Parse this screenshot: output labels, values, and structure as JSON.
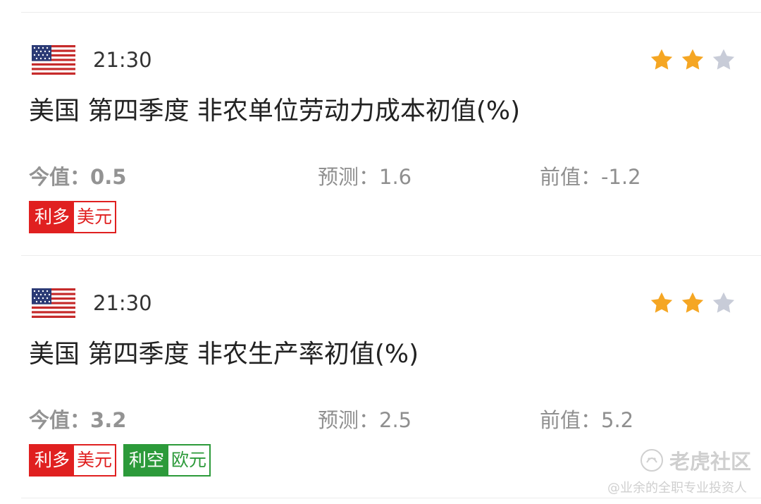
{
  "events": [
    {
      "country_icon": "us-flag-icon",
      "time": "21:30",
      "importance_stars": 2,
      "max_stars": 3,
      "title": "美国 第四季度 非农单位劳动力成本初值(%)",
      "actual_label": "今值：",
      "actual_value": "0.5",
      "forecast_label": "预测：",
      "forecast_value": "1.6",
      "previous_label": "前值：",
      "previous_value": "-1.2",
      "tags": [
        {
          "impact": "利多",
          "currency": "美元",
          "color": "#e02020"
        }
      ]
    },
    {
      "country_icon": "us-flag-icon",
      "time": "21:30",
      "importance_stars": 2,
      "max_stars": 3,
      "title": "美国 第四季度 非农生产率初值(%)",
      "actual_label": "今值：",
      "actual_value": "3.2",
      "forecast_label": "预测：",
      "forecast_value": "2.5",
      "previous_label": "前值：",
      "previous_value": "5.2",
      "tags": [
        {
          "impact": "利多",
          "currency": "美元",
          "color": "#e02020"
        },
        {
          "impact": "利空",
          "currency": "欧元",
          "color": "#2c9a3a"
        }
      ]
    }
  ],
  "colors": {
    "star_on": "#f5a623",
    "star_off": "#c8ccd8"
  },
  "watermark": {
    "brand": "老虎社区",
    "user": "@业余的全职专业投资人"
  }
}
